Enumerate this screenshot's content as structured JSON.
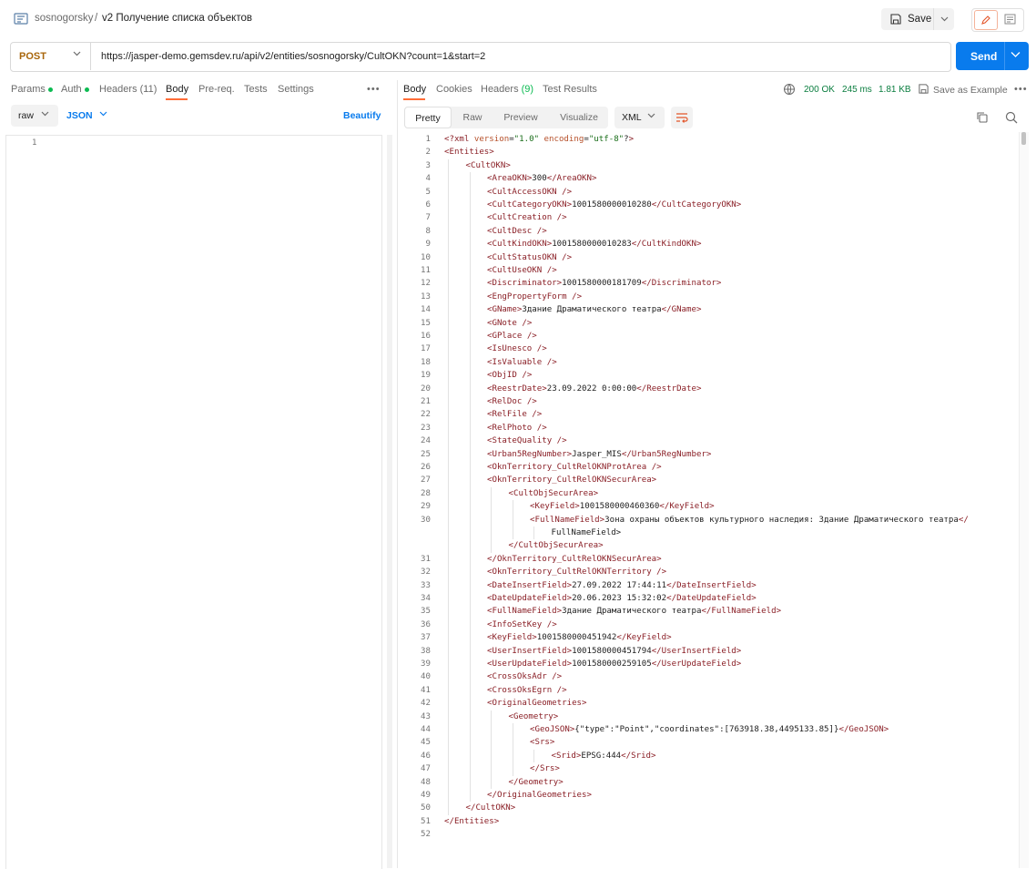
{
  "header": {
    "workspace": "sosnogorsky",
    "separator": "/",
    "request_name": "v2 Получение списка объектов",
    "save_label": "Save"
  },
  "request": {
    "method": "POST",
    "url": "https://jasper-demo.gemsdev.ru/api/v2/entities/sosnogorsky/CultOKN?count=1&start=2",
    "send_label": "Send"
  },
  "request_tabs": [
    {
      "label": "Params",
      "dot": true
    },
    {
      "label": "Auth",
      "dot": true
    },
    {
      "label": "Headers",
      "count": "(11)"
    },
    {
      "label": "Body",
      "active": true
    },
    {
      "label": "Pre-req."
    },
    {
      "label": "Tests"
    },
    {
      "label": "Settings"
    }
  ],
  "more_label": "•••",
  "body_toolbar": {
    "mode": "raw",
    "language": "JSON",
    "beautify_label": "Beautify"
  },
  "request_editor": {
    "line_numbers": [
      "1"
    ]
  },
  "response_tabs": [
    {
      "label": "Body",
      "active": true
    },
    {
      "label": "Cookies"
    },
    {
      "label": "Headers",
      "count": "(9)"
    },
    {
      "label": "Test Results"
    }
  ],
  "response_status": {
    "status": "200 OK",
    "time": "245 ms",
    "size": "1.81 KB",
    "save_example_label": "Save as Example"
  },
  "view_modes": [
    "Pretty",
    "Raw",
    "Preview",
    "Visualize"
  ],
  "active_view": "Pretty",
  "format": "XML",
  "response_lines": [
    {
      "n": "1",
      "d": 0,
      "x": "<?xml version=\"1.0\" encoding=\"utf-8\"?>"
    },
    {
      "n": "2",
      "d": 0,
      "x": "<Entities>"
    },
    {
      "n": "3",
      "d": 1,
      "x": "<CultOKN>"
    },
    {
      "n": "4",
      "d": 2,
      "x": "<AreaOKN>300</AreaOKN>"
    },
    {
      "n": "5",
      "d": 2,
      "x": "<CultAccessOKN />"
    },
    {
      "n": "6",
      "d": 2,
      "x": "<CultCategoryOKN>1001580000010280</CultCategoryOKN>"
    },
    {
      "n": "7",
      "d": 2,
      "x": "<CultCreation />"
    },
    {
      "n": "8",
      "d": 2,
      "x": "<CultDesc />"
    },
    {
      "n": "9",
      "d": 2,
      "x": "<CultKindOKN>1001580000010283</CultKindOKN>"
    },
    {
      "n": "10",
      "d": 2,
      "x": "<CultStatusOKN />"
    },
    {
      "n": "11",
      "d": 2,
      "x": "<CultUseOKN />"
    },
    {
      "n": "12",
      "d": 2,
      "x": "<Discriminator>1001580000181709</Discriminator>"
    },
    {
      "n": "13",
      "d": 2,
      "x": "<EngPropertyForm />"
    },
    {
      "n": "14",
      "d": 2,
      "x": "<GName>Здание Драматического театра</GName>"
    },
    {
      "n": "15",
      "d": 2,
      "x": "<GNote />"
    },
    {
      "n": "16",
      "d": 2,
      "x": "<GPlace />"
    },
    {
      "n": "17",
      "d": 2,
      "x": "<IsUnesco />"
    },
    {
      "n": "18",
      "d": 2,
      "x": "<IsValuable />"
    },
    {
      "n": "19",
      "d": 2,
      "x": "<ObjID />"
    },
    {
      "n": "20",
      "d": 2,
      "x": "<ReestrDate>23.09.2022 0:00:00</ReestrDate>"
    },
    {
      "n": "21",
      "d": 2,
      "x": "<RelDoc />"
    },
    {
      "n": "22",
      "d": 2,
      "x": "<RelFile />"
    },
    {
      "n": "23",
      "d": 2,
      "x": "<RelPhoto />"
    },
    {
      "n": "24",
      "d": 2,
      "x": "<StateQuality />"
    },
    {
      "n": "25",
      "d": 2,
      "x": "<Urban5RegNumber>Jasper_MIS</Urban5RegNumber>"
    },
    {
      "n": "26",
      "d": 2,
      "x": "<OknTerritory_CultRelOKNProtArea />"
    },
    {
      "n": "27",
      "d": 2,
      "x": "<OknTerritory_CultRelOKNSecurArea>"
    },
    {
      "n": "28",
      "d": 3,
      "x": "<CultObjSecurArea>"
    },
    {
      "n": "29",
      "d": 4,
      "x": "<KeyField>1001580000460360</KeyField>"
    },
    {
      "n": "30",
      "d": 4,
      "x": "<FullNameField>Зона охраны объектов культурного наследия: Здание Драматического театра</"
    },
    {
      "n": "",
      "d": 5,
      "x": "FullNameField>"
    },
    {
      "n": "",
      "d": 3,
      "x": "</CultObjSecurArea>"
    },
    {
      "n": "31",
      "d": 2,
      "x": "</OknTerritory_CultRelOKNSecurArea>"
    },
    {
      "n": "32",
      "d": 2,
      "x": "<OknTerritory_CultRelOKNTerritory />"
    },
    {
      "n": "33",
      "d": 2,
      "x": "<DateInsertField>27.09.2022 17:44:11</DateInsertField>"
    },
    {
      "n": "34",
      "d": 2,
      "x": "<DateUpdateField>20.06.2023 15:32:02</DateUpdateField>"
    },
    {
      "n": "35",
      "d": 2,
      "x": "<FullNameField>Здание Драматического театра</FullNameField>"
    },
    {
      "n": "36",
      "d": 2,
      "x": "<InfoSetKey />"
    },
    {
      "n": "37",
      "d": 2,
      "x": "<KeyField>1001580000451942</KeyField>"
    },
    {
      "n": "38",
      "d": 2,
      "x": "<UserInsertField>1001580000451794</UserInsertField>"
    },
    {
      "n": "39",
      "d": 2,
      "x": "<UserUpdateField>1001580000259105</UserUpdateField>"
    },
    {
      "n": "40",
      "d": 2,
      "x": "<CrossOksAdr />"
    },
    {
      "n": "41",
      "d": 2,
      "x": "<CrossOksEgrn />"
    },
    {
      "n": "42",
      "d": 2,
      "x": "<OriginalGeometries>"
    },
    {
      "n": "43",
      "d": 3,
      "x": "<Geometry>"
    },
    {
      "n": "44",
      "d": 4,
      "x": "<GeoJSON>{\"type\":\"Point\",\"coordinates\":[763918.38,4495133.85]}</GeoJSON>"
    },
    {
      "n": "45",
      "d": 4,
      "x": "<Srs>"
    },
    {
      "n": "46",
      "d": 5,
      "x": "<Srid>EPSG:444</Srid>"
    },
    {
      "n": "47",
      "d": 4,
      "x": "</Srs>"
    },
    {
      "n": "48",
      "d": 3,
      "x": "</Geometry>"
    },
    {
      "n": "49",
      "d": 2,
      "x": "</OriginalGeometries>"
    },
    {
      "n": "50",
      "d": 1,
      "x": "</CultOKN>"
    },
    {
      "n": "51",
      "d": 0,
      "x": "</Entities>"
    },
    {
      "n": "52",
      "d": 0,
      "x": ""
    }
  ],
  "colors": {
    "accent": "#ff6c37",
    "send": "#097bed",
    "status_ok": "#0a7d3f",
    "method": "#a8650a"
  }
}
